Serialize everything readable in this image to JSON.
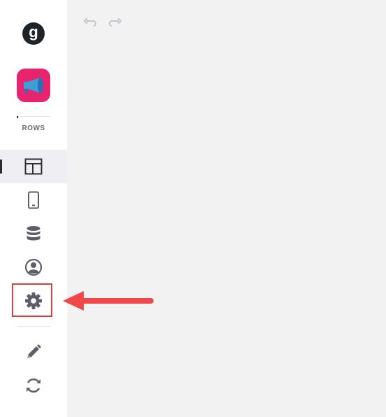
{
  "sidebar": {
    "logo_letter": "g",
    "section_label": "ROWS",
    "nav_items": [
      {
        "name": "layout",
        "active": true
      },
      {
        "name": "mobile",
        "active": false
      },
      {
        "name": "data",
        "active": false
      },
      {
        "name": "users",
        "active": false
      },
      {
        "name": "settings",
        "active": false
      },
      {
        "name": "edit",
        "active": false
      },
      {
        "name": "sync",
        "active": false
      }
    ]
  },
  "toolbar": {
    "undo_icon": "undo-icon",
    "redo_icon": "redo-icon"
  },
  "colors": {
    "app_icon_bg": "#e8246e",
    "highlight": "#e23b3b",
    "arrow": "#f04848",
    "icon": "#6b6b78",
    "canvas_bg": "#f2f2f3"
  }
}
